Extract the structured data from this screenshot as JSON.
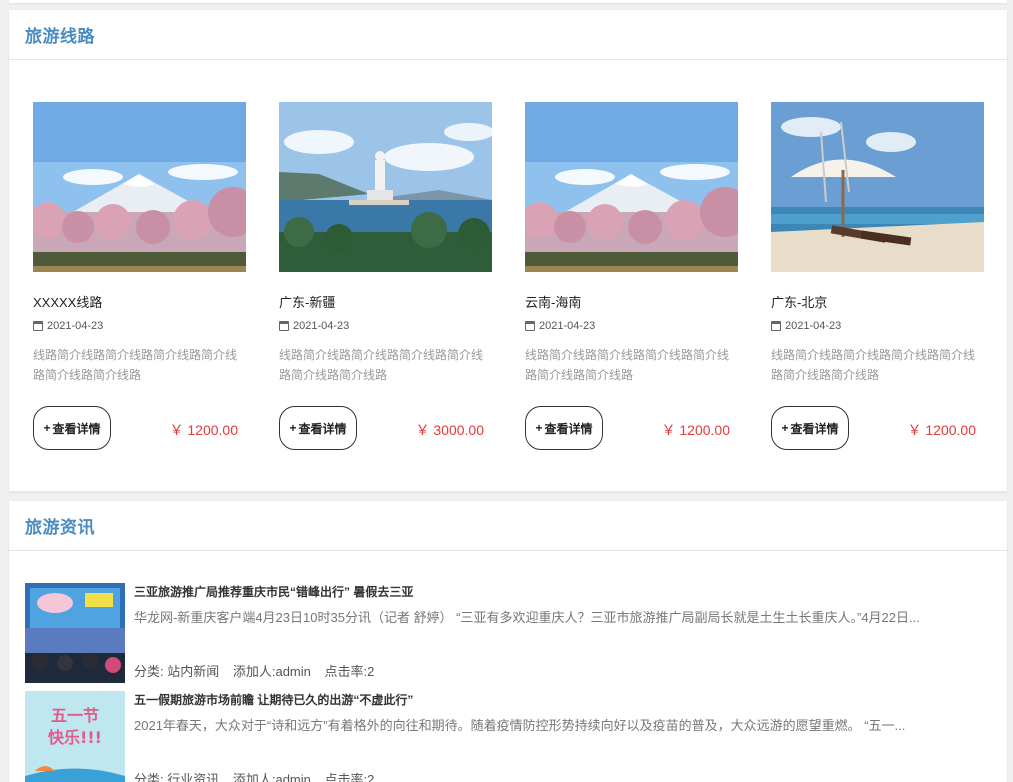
{
  "routes_section": {
    "title": "旅游线路",
    "cards": [
      {
        "name": "XXXXX线路",
        "date": "2021-04-23",
        "desc": "线路简介线路简介线路简介线路简介线路简介线路简介线路",
        "button": "查看详情",
        "price": "￥ 1200.00",
        "image": "mountain-blossom-image"
      },
      {
        "name": "广东-新疆",
        "date": "2021-04-23",
        "desc": "线路简介线路简介线路简介线路简介线路简介线路简介线路",
        "button": "查看详情",
        "price": "￥ 3000.00",
        "image": "statue-sea-image"
      },
      {
        "name": "云南-海南",
        "date": "2021-04-23",
        "desc": "线路简介线路简介线路简介线路简介线路简介线路简介线路",
        "button": "查看详情",
        "price": "￥ 1200.00",
        "image": "mountain-blossom-image"
      },
      {
        "name": "广东-北京",
        "date": "2021-04-23",
        "desc": "线路简介线路简介线路简介线路简介线路简介线路简介线路",
        "button": "查看详情",
        "price": "￥ 1200.00",
        "image": "beach-umbrella-image"
      }
    ]
  },
  "news_section": {
    "title": "旅游资讯",
    "items": [
      {
        "title": "三亚旅游推广局推荐重庆市民“错峰出行” 暑假去三亚",
        "summary": "华龙网-新重庆客户端4月23日10时35分讯（记者 舒婷） “三亚有多欢迎重庆人？三亚市旅游推广局副局长就是土生土长重庆人。”4月22日...",
        "category": "分类: 站内新闻",
        "author": "添加人:admin",
        "clicks": "点击率:2"
      },
      {
        "title": "五一假期旅游市场前瞻 让期待已久的出游“不虚此行”",
        "summary": "2021年春天，大众对于“诗和远方”有着格外的向往和期待。随着疫情防控形势持续向好以及疫苗的普及，大众远游的愿望重燃。 “五一...",
        "category": "分类: 行业资讯",
        "author": "添加人:admin",
        "clicks": "点击率:2",
        "thumb_text": "五一节快乐!!!"
      }
    ]
  },
  "colors": {
    "accent": "#4a8cc0",
    "price": "#e23a3a"
  }
}
